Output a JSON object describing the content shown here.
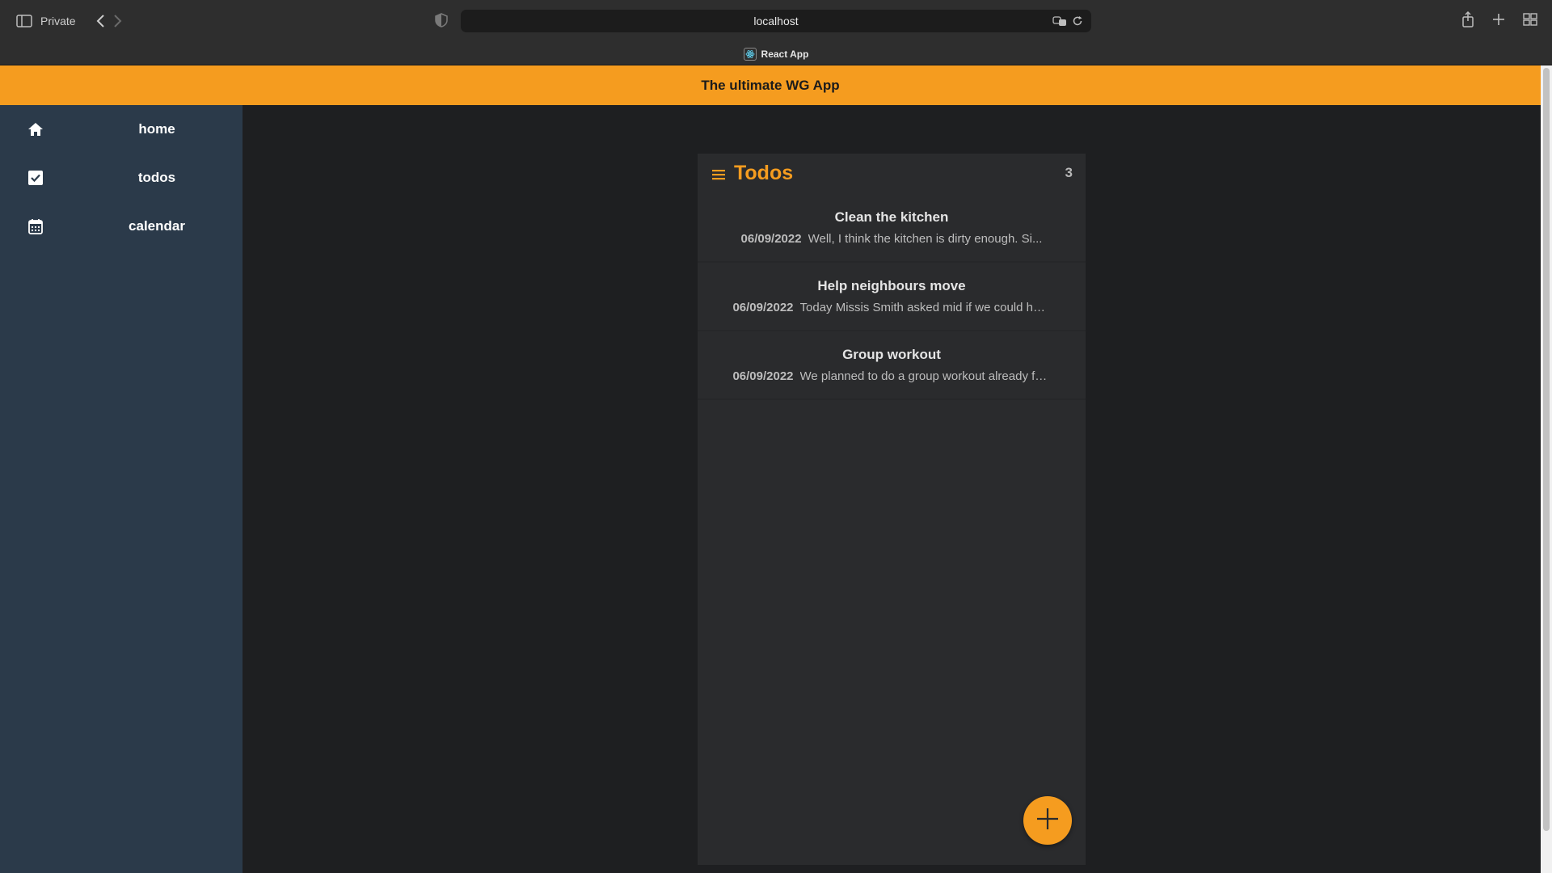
{
  "browser": {
    "mode_label": "Private",
    "url": "localhost",
    "tab_title": "React App"
  },
  "app": {
    "title": "The ultimate WG App",
    "accent_color": "#f59c1f",
    "sidebar_color": "#2b3a4a"
  },
  "sidebar": {
    "items": [
      {
        "label": "home",
        "icon": "home-icon"
      },
      {
        "label": "todos",
        "icon": "checkbox-icon"
      },
      {
        "label": "calendar",
        "icon": "calendar-icon"
      }
    ]
  },
  "todos": {
    "title": "Todos",
    "count": "3",
    "items": [
      {
        "title": "Clean the kitchen",
        "date": "06/09/2022",
        "description": "Well, I think the kitchen is dirty enough. Si..."
      },
      {
        "title": "Help neighbours move",
        "date": "06/09/2022",
        "description": "Today Missis Smith asked mid if we could help..."
      },
      {
        "title": "Group workout",
        "date": "06/09/2022",
        "description": "We planned to do a group workout already for ..."
      }
    ],
    "add_icon": "plus-icon"
  }
}
